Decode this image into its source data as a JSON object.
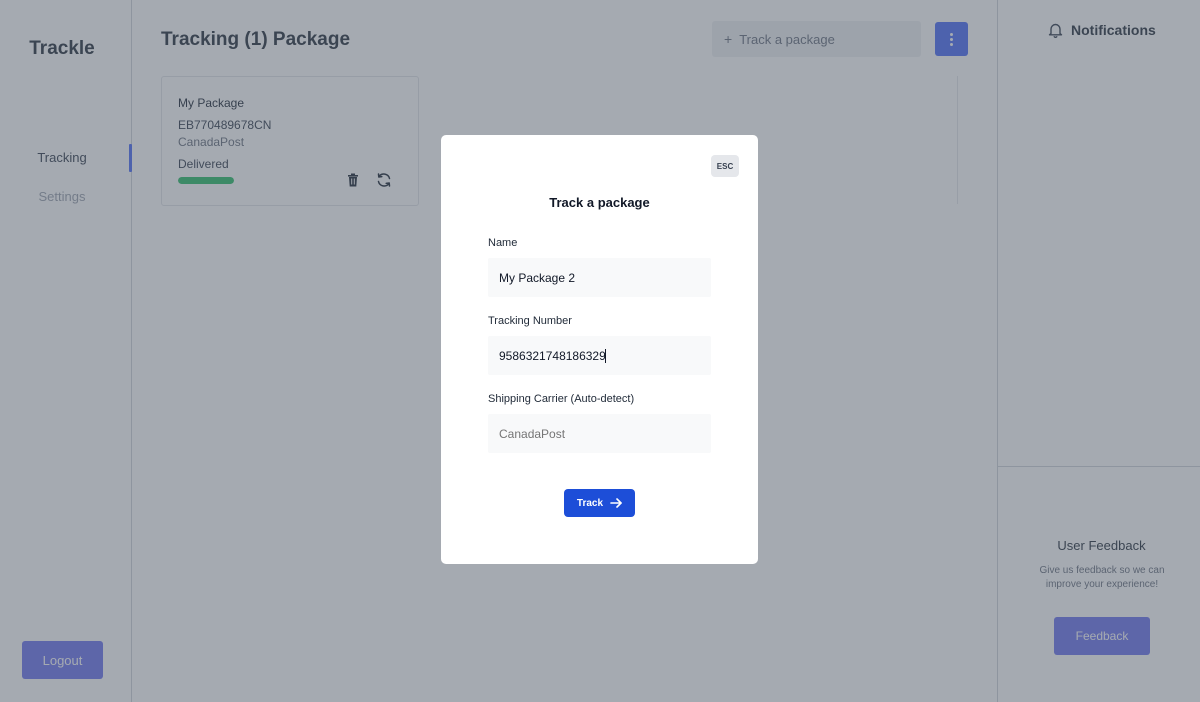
{
  "app": {
    "brand": "Trackle"
  },
  "sidebar": {
    "items": [
      {
        "label": "Tracking",
        "active": true
      },
      {
        "label": "Settings",
        "active": false
      }
    ],
    "logout_label": "Logout"
  },
  "main": {
    "title": "Tracking (1) Package",
    "search_placeholder": "Track a package",
    "package": {
      "name": "My Package",
      "number": "EB770489678CN",
      "carrier": "CanadaPost",
      "status": "Delivered",
      "progress_percent": 100
    }
  },
  "notifications": {
    "title": "Notifications"
  },
  "feedback": {
    "title": "User Feedback",
    "text": "Give us feedback so we can improve your experience!",
    "button_label": "Feedback"
  },
  "modal": {
    "esc_label": "ESC",
    "title": "Track a package",
    "name_label": "Name",
    "name_value": "My Package 2",
    "tracking_label": "Tracking Number",
    "tracking_value": "9586321748186329",
    "carrier_label": "Shipping Carrier (Auto-detect)",
    "carrier_placeholder": "CanadaPost",
    "track_label": "Track"
  },
  "colors": {
    "accent": "#4f6ef7",
    "button_purple": "#6f77ee",
    "track_button": "#1d4ed8",
    "delivered_green": "#2fbf6a"
  },
  "icons": [
    "plus-icon",
    "kebab-menu-icon",
    "trash-icon",
    "refresh-icon",
    "bell-icon",
    "arrow-right-icon"
  ]
}
